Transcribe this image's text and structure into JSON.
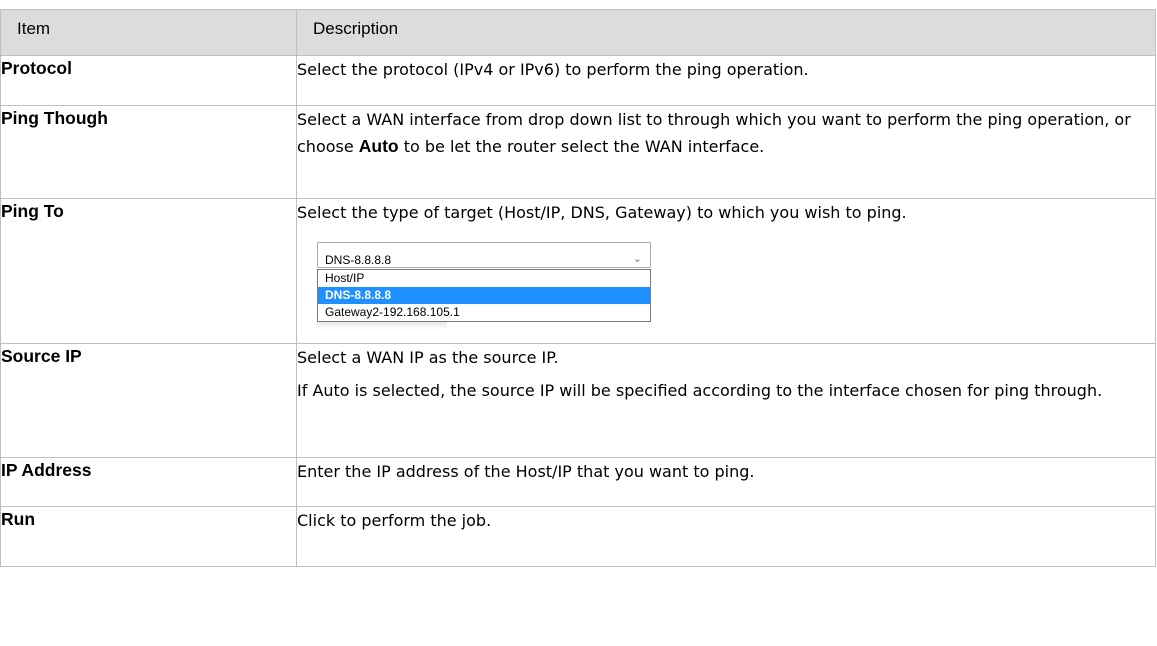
{
  "header": {
    "item": "Item",
    "description": "Description"
  },
  "rows": [
    {
      "item": "Protocol",
      "description": "Select the protocol (IPv4 or IPv6) to perform the ping operation."
    },
    {
      "item": "Ping Though",
      "description_before": "Select a WAN interface from drop down list to through which you want to perform the ping operation, or choose ",
      "description_bold": "Auto",
      "description_after": " to be let the router select the WAN interface."
    },
    {
      "item": "Ping To",
      "description": "Select the type of target (Host/IP, DNS, Gateway) to which you wish to ping.",
      "dropdown": {
        "selected": "DNS-8.8.8.8",
        "options": [
          "Host/IP",
          "DNS-8.8.8.8",
          "Gateway2-192.168.105.1"
        ],
        "highlighted_index": 1,
        "chevron_icon": "chevron-down-icon"
      }
    },
    {
      "item": "Source IP",
      "description": "Select a WAN IP as the source IP.",
      "description_2": "If Auto is selected, the source IP will be specified according to the interface chosen for ping through."
    },
    {
      "item": "IP Address",
      "description": "Enter the IP address of the Host/IP that you want to ping."
    },
    {
      "item": "Run",
      "description": "Click to perform the job."
    }
  ],
  "colors": {
    "header_bg": "#dcdcdc",
    "border": "#bfbfbf",
    "highlight": "#1e90ff"
  }
}
